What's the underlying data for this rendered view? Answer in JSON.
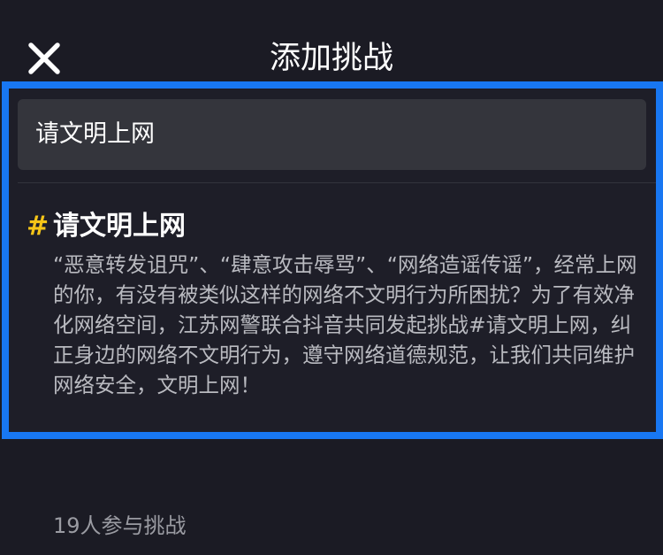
{
  "header": {
    "title": "添加挑战",
    "close_icon": "close-icon"
  },
  "search": {
    "value": "请文明上网"
  },
  "challenge": {
    "hash_symbol": "#",
    "name": "请文明上网",
    "description": "“恶意转发诅咒”、“肆意攻击辱骂”、“网络造谣传谣”，经常上网的你，有没有被类似这样的网络不文明行为所困扰？为了有效净化网络空间，江苏网警联合抖音共同发起挑战#请文明上网，纠正身边的网络不文明行为，遵守网络道德规范，让我们共同维护网络安全，文明上网！"
  },
  "participants": {
    "text": "19人参与挑战"
  },
  "colors": {
    "background": "#1b1b24",
    "highlight_border": "#1877f2",
    "hash_accent": "#f5c518",
    "search_bg": "#34353c"
  }
}
